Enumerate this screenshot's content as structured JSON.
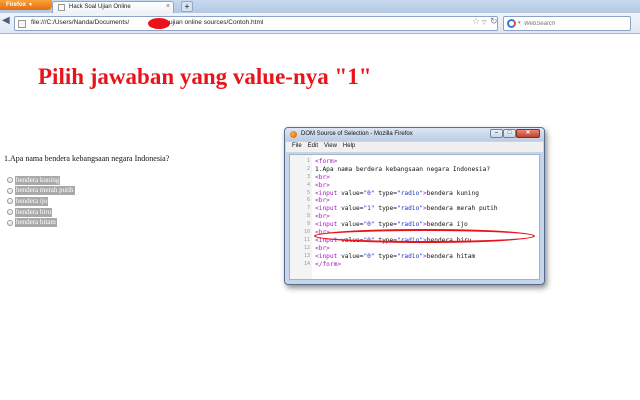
{
  "browser": {
    "app_button": "Firefox",
    "tab_title": "Hack Soal Ujian Online",
    "url_before": "file:///C:/Users/Nanda/Documents/",
    "url_after": "soal ujian online sources/Contoh.html",
    "search_placeholder": "WebSearch",
    "redaction_color": "#e8141b"
  },
  "page": {
    "heading": "Pilih jawaban yang value-nya \"1\"",
    "question": "1.Apa nama bendera kebangsaan negara Indonesia?",
    "options": [
      {
        "label": "bendera kuning"
      },
      {
        "label": "bendera merah putih"
      },
      {
        "label": "bendera ijo"
      },
      {
        "label": "bendera biru"
      },
      {
        "label": "bendera hitam"
      }
    ]
  },
  "source_window": {
    "title": "DOM Source of Selection - Mozilla Firefox",
    "menu": [
      "File",
      "Edit",
      "View",
      "Help"
    ],
    "lines": [
      {
        "n": "1",
        "parts": [
          [
            "tag",
            "<form>"
          ]
        ]
      },
      {
        "n": "2",
        "parts": [
          [
            "txt",
            "1.Apa nama berdera kebangsaan negara Indonesia?"
          ]
        ]
      },
      {
        "n": "3",
        "parts": [
          [
            "tag",
            "<br>"
          ]
        ]
      },
      {
        "n": "4",
        "parts": [
          [
            "tag",
            "<br>"
          ]
        ]
      },
      {
        "n": "5",
        "parts": [
          [
            "tag",
            "<input "
          ],
          [
            "attr",
            "value="
          ],
          [
            "val",
            "\"0\""
          ],
          [
            "attr",
            " type="
          ],
          [
            "val",
            "\"radio\""
          ],
          [
            "tag",
            ">"
          ],
          [
            "txt",
            "bendera kuning"
          ]
        ]
      },
      {
        "n": "6",
        "parts": [
          [
            "tag",
            "<br>"
          ]
        ]
      },
      {
        "n": "7",
        "parts": [
          [
            "tag",
            "<input "
          ],
          [
            "attr",
            "value="
          ],
          [
            "val",
            "\"1\""
          ],
          [
            "attr",
            " type="
          ],
          [
            "val",
            "\"radio\""
          ],
          [
            "tag",
            ">"
          ],
          [
            "txt",
            "bendera merah putih"
          ]
        ]
      },
      {
        "n": "8",
        "parts": [
          [
            "tag",
            "<br>"
          ]
        ]
      },
      {
        "n": "9",
        "parts": [
          [
            "tag",
            "<input "
          ],
          [
            "attr",
            "value="
          ],
          [
            "val",
            "\"0\""
          ],
          [
            "attr",
            " type="
          ],
          [
            "val",
            "\"radio\""
          ],
          [
            "tag",
            ">"
          ],
          [
            "txt",
            "bendera ijo"
          ]
        ]
      },
      {
        "n": "10",
        "parts": [
          [
            "tag",
            "<br>"
          ]
        ]
      },
      {
        "n": "11",
        "parts": [
          [
            "tag",
            "<input "
          ],
          [
            "attr",
            "value="
          ],
          [
            "val",
            "\"0\""
          ],
          [
            "attr",
            " type="
          ],
          [
            "val",
            "\"radio\""
          ],
          [
            "tag",
            ">"
          ],
          [
            "txt",
            "bendera biru"
          ]
        ]
      },
      {
        "n": "12",
        "parts": [
          [
            "tag",
            "<br>"
          ]
        ]
      },
      {
        "n": "13",
        "parts": [
          [
            "tag",
            "<input "
          ],
          [
            "attr",
            "value="
          ],
          [
            "val",
            "\"0\""
          ],
          [
            "attr",
            " type="
          ],
          [
            "val",
            "\"radio\""
          ],
          [
            "tag",
            ">"
          ],
          [
            "txt",
            "bendera hitam"
          ]
        ]
      },
      {
        "n": "14",
        "parts": [
          [
            "tag",
            "</form>"
          ]
        ]
      }
    ],
    "highlight_color": "#e8141b"
  }
}
